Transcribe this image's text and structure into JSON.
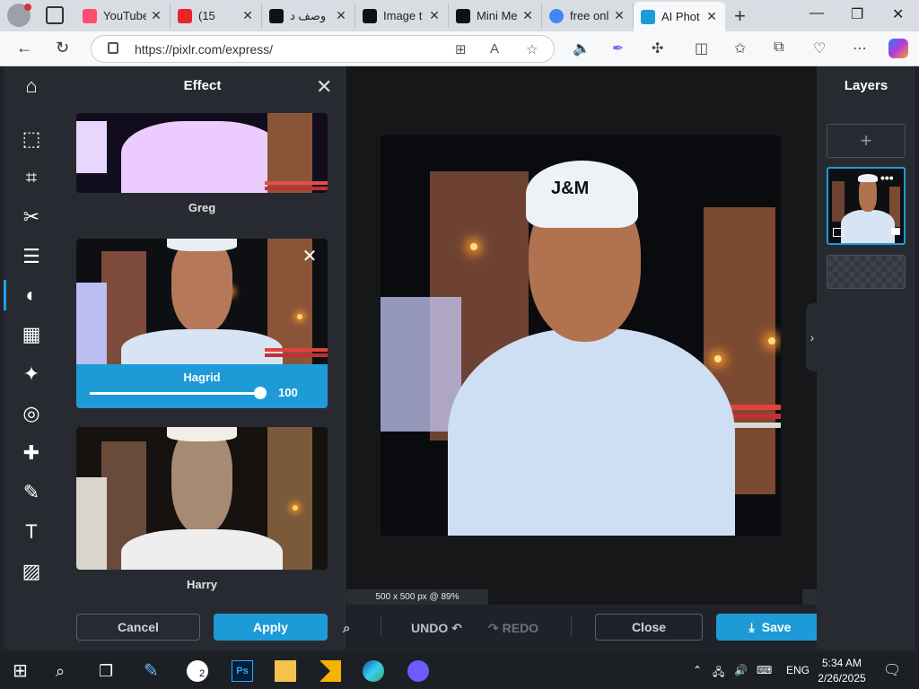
{
  "browser": {
    "tabs": [
      {
        "title": "YouTube",
        "favicon_color": "#ff4d6d"
      },
      {
        "title": "(15",
        "favicon_color": "#e8232b"
      },
      {
        "title": "وصف د",
        "favicon_color": "#111111"
      },
      {
        "title": "Image t",
        "favicon_color": "#111111"
      },
      {
        "title": "Mini Me",
        "favicon_color": "#111111"
      },
      {
        "title": "free onl",
        "favicon_color": "#4285f4"
      },
      {
        "title": "AI Phot",
        "favicon_color": "#1e9bd7"
      }
    ],
    "url": "https://pixlr.com/express/"
  },
  "effect_panel": {
    "title": "Effect",
    "effects": [
      {
        "name": "Greg"
      },
      {
        "name": "Hagrid",
        "selected": true,
        "intensity": 100
      },
      {
        "name": "Harry"
      }
    ],
    "cancel_label": "Cancel",
    "apply_label": "Apply"
  },
  "canvas": {
    "image_text": "J&M",
    "status": "500 x 500 px @ 89%"
  },
  "bottom_bar": {
    "undo_label": "UNDO",
    "redo_label": "REDO",
    "close_label": "Close",
    "save_label": "Save"
  },
  "layers_panel": {
    "title": "Layers",
    "add_symbol": "+"
  },
  "taskbar": {
    "language": "ENG",
    "time": "5:34 AM",
    "date": "2/26/2025",
    "whatsapp_badge": "2"
  },
  "colors": {
    "accent": "#1e9bd7",
    "panel": "#272b31",
    "canvas_bg": "#151719"
  },
  "icons": {
    "rail": [
      "home-icon",
      "arrange-icon",
      "crop-icon",
      "cutout-icon",
      "adjust-icon",
      "filter-icon",
      "effect-icon",
      "liquify-icon",
      "retouch-icon",
      "heal-icon",
      "draw-icon",
      "text-icon",
      "pattern-icon"
    ]
  }
}
